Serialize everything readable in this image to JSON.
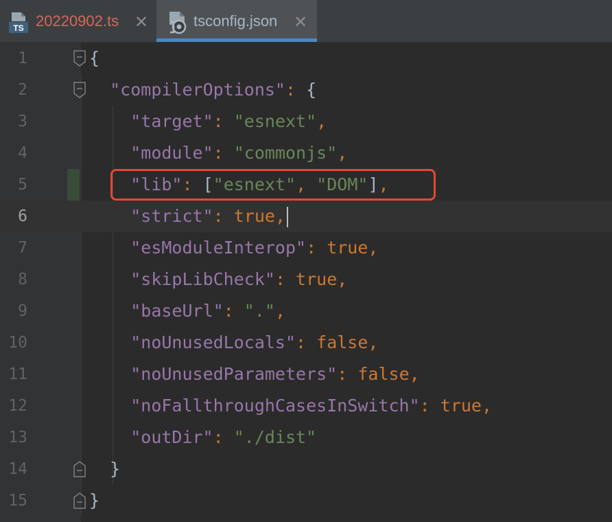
{
  "tabs": [
    {
      "label": "20220902.ts",
      "icon": "typescript-file-icon",
      "icon_text": "TS"
    },
    {
      "label": "tsconfig.json",
      "icon": "tsconfig-json-file-icon",
      "active": true
    }
  ],
  "editor": {
    "current_line": 6,
    "highlighted_line": 5,
    "lines": [
      {
        "n": "1"
      },
      {
        "n": "2"
      },
      {
        "n": "3"
      },
      {
        "n": "4"
      },
      {
        "n": "5"
      },
      {
        "n": "6"
      },
      {
        "n": "7"
      },
      {
        "n": "8"
      },
      {
        "n": "9"
      },
      {
        "n": "10"
      },
      {
        "n": "11"
      },
      {
        "n": "12"
      },
      {
        "n": "13"
      },
      {
        "n": "14"
      },
      {
        "n": "15"
      }
    ],
    "tokens": {
      "l1": {
        "brace": "{"
      },
      "l2": {
        "key": "\"compilerOptions\"",
        "colon": ": ",
        "brace": "{"
      },
      "l3": {
        "key": "\"target\"",
        "colon": ": ",
        "val": "\"esnext\"",
        "comma": ","
      },
      "l4": {
        "key": "\"module\"",
        "colon": ": ",
        "val": "\"commonjs\"",
        "comma": ","
      },
      "l5": {
        "key": "\"lib\"",
        "colon": ": ",
        "open": "[",
        "v1": "\"esnext\"",
        "sep": ", ",
        "v2": "\"DOM\"",
        "close": "]",
        "comma": ","
      },
      "l6": {
        "key": "\"strict\"",
        "colon": ": ",
        "val": "true",
        "comma": ","
      },
      "l7": {
        "key": "\"esModuleInterop\"",
        "colon": ": ",
        "val": "true",
        "comma": ","
      },
      "l8": {
        "key": "\"skipLibCheck\"",
        "colon": ": ",
        "val": "true",
        "comma": ","
      },
      "l9": {
        "key": "\"baseUrl\"",
        "colon": ": ",
        "val": "\".\"",
        "comma": ","
      },
      "l10": {
        "key": "\"noUnusedLocals\"",
        "colon": ": ",
        "val": "false",
        "comma": ","
      },
      "l11": {
        "key": "\"noUnusedParameters\"",
        "colon": ": ",
        "val": "false",
        "comma": ","
      },
      "l12": {
        "key": "\"noFallthroughCasesInSwitch\"",
        "colon": ": ",
        "val": "true",
        "comma": ","
      },
      "l13": {
        "key": "\"outDir\"",
        "colon": ": ",
        "val": "\"./dist\""
      },
      "l14": {
        "brace": "}"
      },
      "l15": {
        "brace": "}"
      }
    }
  },
  "colors": {
    "background": "#2b2b2b",
    "key": "#9876aa",
    "string": "#6a8759",
    "keyword": "#cc7832",
    "highlight_box": "#e64833",
    "tab_accent": "#4a88c7"
  }
}
